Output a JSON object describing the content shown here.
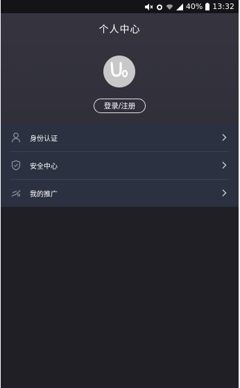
{
  "status_bar": {
    "battery": "40%",
    "time": "13:32"
  },
  "header": {
    "title": "个人中心",
    "login_button": "登录/注册"
  },
  "menu": {
    "items": [
      {
        "label": "身份认证",
        "icon": "person-icon"
      },
      {
        "label": "安全中心",
        "icon": "shield-check-icon"
      },
      {
        "label": "我的推广",
        "icon": "spread-icon"
      }
    ]
  },
  "colors": {
    "background": "#201f25",
    "header": "#35343f",
    "menu": "#2b3140"
  }
}
